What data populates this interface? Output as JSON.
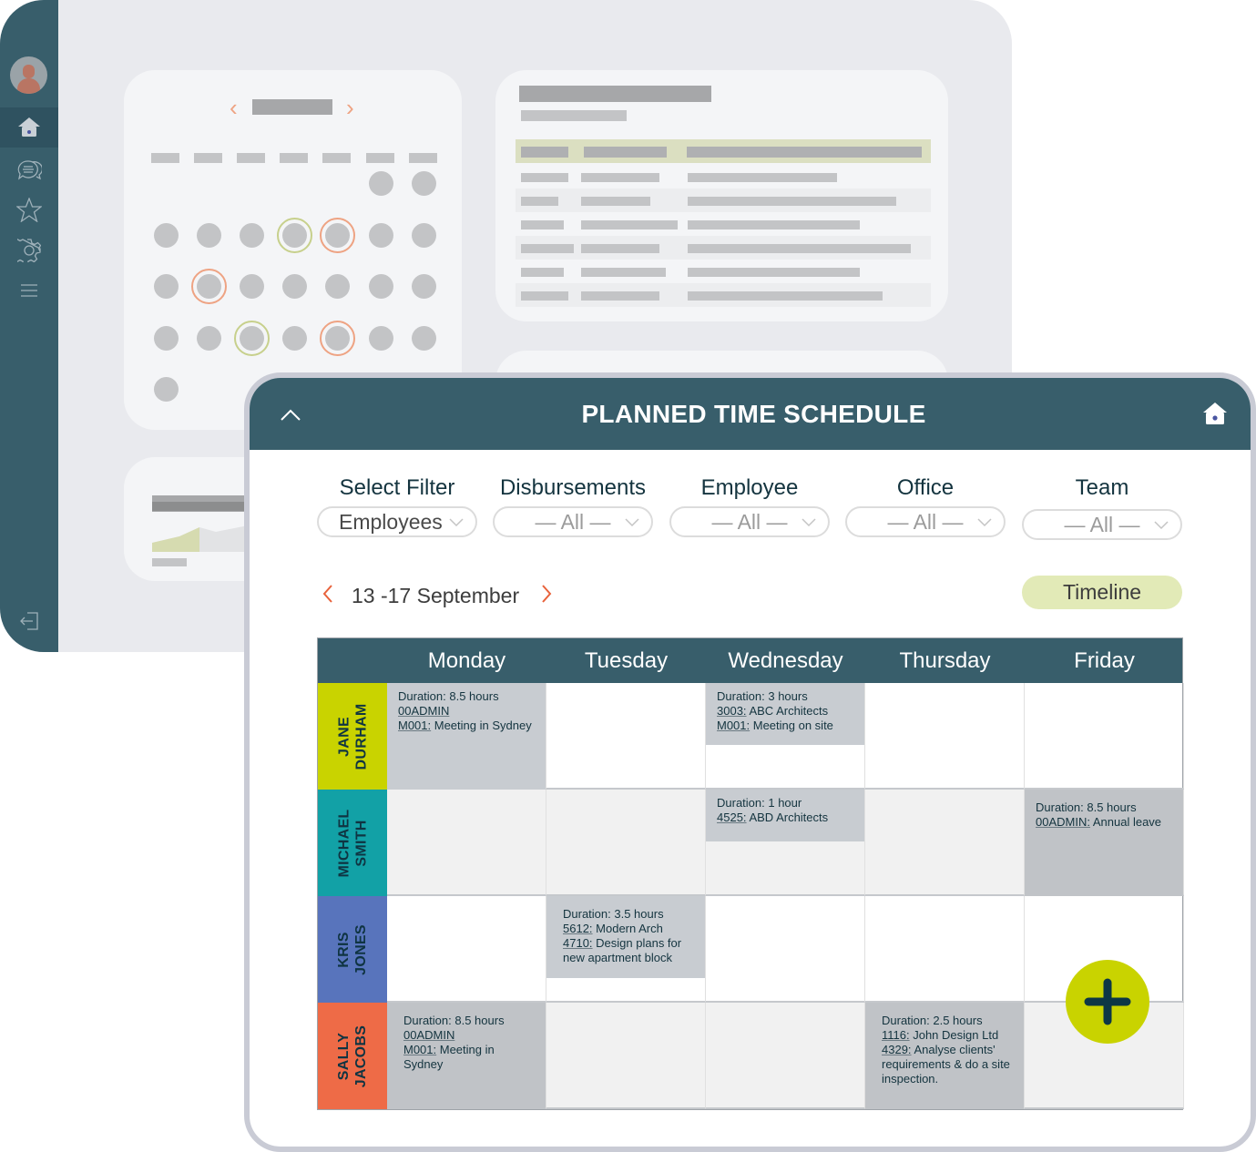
{
  "background_app": {
    "sidebar": {
      "items": [
        {
          "icon": "home-icon",
          "active": true
        },
        {
          "icon": "chat-icon",
          "active": false
        },
        {
          "icon": "star-icon",
          "active": false
        },
        {
          "icon": "gear-icon",
          "active": false
        },
        {
          "icon": "menu-icon",
          "active": false
        }
      ],
      "logout_icon": "logout-icon"
    }
  },
  "panel": {
    "title": "PLANNED TIME SCHEDULE",
    "filters": [
      {
        "label": "Select Filter",
        "value": "Employees"
      },
      {
        "label": "Disbursements",
        "value": "— All —"
      },
      {
        "label": "Employee",
        "value": "— All —"
      },
      {
        "label": "Office",
        "value": "— All —"
      },
      {
        "label": "Team",
        "value": "— All —"
      }
    ],
    "week_label": "13 -17 September",
    "timeline_label": "Timeline",
    "days": [
      "Monday",
      "Tuesday",
      "Wednesday",
      "Thursday",
      "Friday"
    ],
    "employees": [
      {
        "name": "JANE\nDURHAM",
        "color": "#c9d300"
      },
      {
        "name": "MICHAEL\nSMITH",
        "color": "#12a1a6"
      },
      {
        "name": "KRIS\nJONES",
        "color": "#5874bc"
      },
      {
        "name": "SALLY\nJACOBS",
        "color": "#ee6b47"
      }
    ],
    "entries": [
      {
        "employee": 0,
        "day": 0,
        "duration": "Duration: 8.5 hours",
        "lines": [
          {
            "code": "00ADMIN",
            "text": ""
          },
          {
            "code": "M001:",
            "text": " Meeting in Sydney"
          }
        ]
      },
      {
        "employee": 0,
        "day": 2,
        "duration": "Duration: 3 hours",
        "lines": [
          {
            "code": "3003:",
            "text": " ABC Architects"
          },
          {
            "code": "M001:",
            "text": " Meeting on site"
          }
        ]
      },
      {
        "employee": 1,
        "day": 2,
        "duration": "Duration: 1 hour",
        "lines": [
          {
            "code": "4525:",
            "text": " ABD Architects"
          }
        ]
      },
      {
        "employee": 1,
        "day": 4,
        "duration": "Duration: 8.5 hours",
        "lines": [
          {
            "code": "00ADMIN:",
            "text": " Annual leave"
          }
        ]
      },
      {
        "employee": 2,
        "day": 1,
        "duration": "Duration: 3.5 hours",
        "lines": [
          {
            "code": "5612:",
            "text": " Modern Arch"
          },
          {
            "code": "4710:",
            "text": " Design plans for new apartment block"
          }
        ]
      },
      {
        "employee": 3,
        "day": 0,
        "duration": "Duration: 8.5 hours",
        "lines": [
          {
            "code": "00ADMIN",
            "text": ""
          },
          {
            "code": "M001:",
            "text": " Meeting in Sydney"
          }
        ]
      },
      {
        "employee": 3,
        "day": 3,
        "duration": "Duration: 2.5 hours",
        "lines": [
          {
            "code": "1116:",
            "text": " John Design Ltd"
          },
          {
            "code": "4329:",
            "text": " Analyse clients' requirements & do a site inspection."
          }
        ]
      }
    ],
    "add_button_icon": "plus-icon"
  }
}
